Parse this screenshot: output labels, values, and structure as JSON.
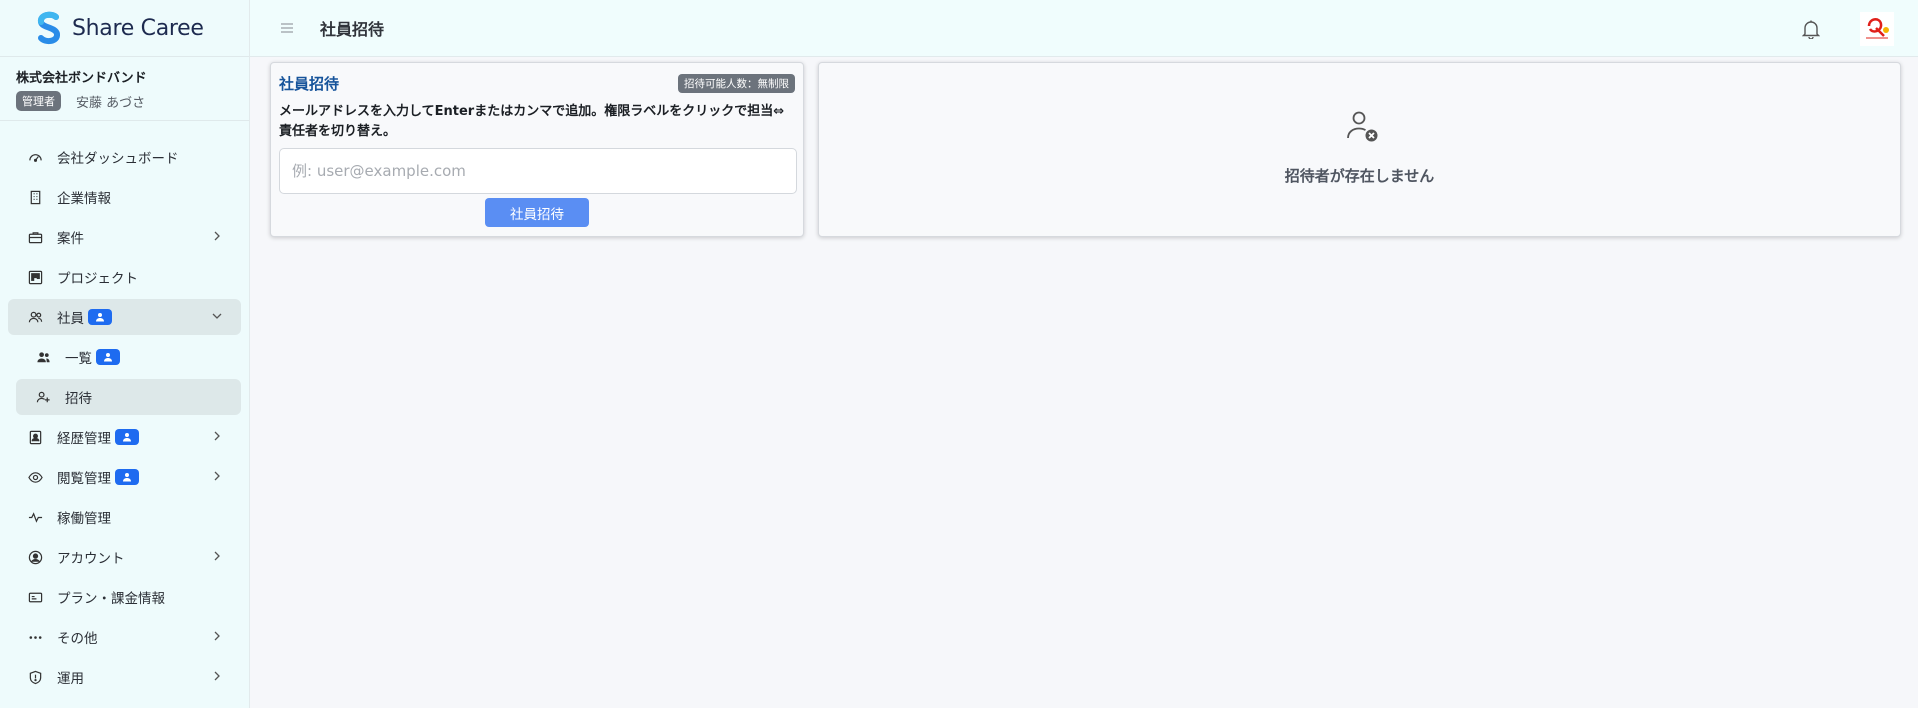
{
  "app": {
    "logo_text": "Share Caree"
  },
  "company": {
    "name": "株式会社ボンドバンド",
    "role_badge": "管理者",
    "user_name": "安藤 あづさ"
  },
  "sidebar": {
    "items": [
      {
        "label": "会社ダッシュボード",
        "icon": "dashboard-icon"
      },
      {
        "label": "企業情報",
        "icon": "building-icon"
      },
      {
        "label": "案件",
        "icon": "briefcase-icon"
      },
      {
        "label": "プロジェクト",
        "icon": "kanban-icon"
      },
      {
        "label": "社員",
        "icon": "people-icon"
      },
      {
        "label": "一覧",
        "icon": "people-fill-icon"
      },
      {
        "label": "招待",
        "icon": "person-add-icon"
      },
      {
        "label": "経歴管理",
        "icon": "person-badge-icon"
      },
      {
        "label": "閲覧管理",
        "icon": "eye-icon"
      },
      {
        "label": "稼働管理",
        "icon": "activity-icon"
      },
      {
        "label": "アカウント",
        "icon": "person-circle-icon"
      },
      {
        "label": "プラン・課金情報",
        "icon": "credit-card-icon"
      },
      {
        "label": "その他",
        "icon": "three-dots-icon"
      },
      {
        "label": "運用",
        "icon": "shield-icon"
      }
    ]
  },
  "header": {
    "title": "社員招待"
  },
  "invite": {
    "title": "社員招待",
    "limit_badge": "招待可能人数：無制限",
    "instruction": "メールアドレスを入力してEnterまたはカンマで追加。権限ラベルをクリックで担当⇔責任者を切り替え。",
    "input_placeholder": "例: user@example.com",
    "input_value": "",
    "button_label": "社員招待"
  },
  "empty_state": {
    "message": "招待者が存在しません"
  },
  "colors": {
    "accent": "#1e6bf0",
    "button": "#5a8ef3",
    "title_blue": "#17549b",
    "sidebar_bg": "#eefbfc"
  }
}
